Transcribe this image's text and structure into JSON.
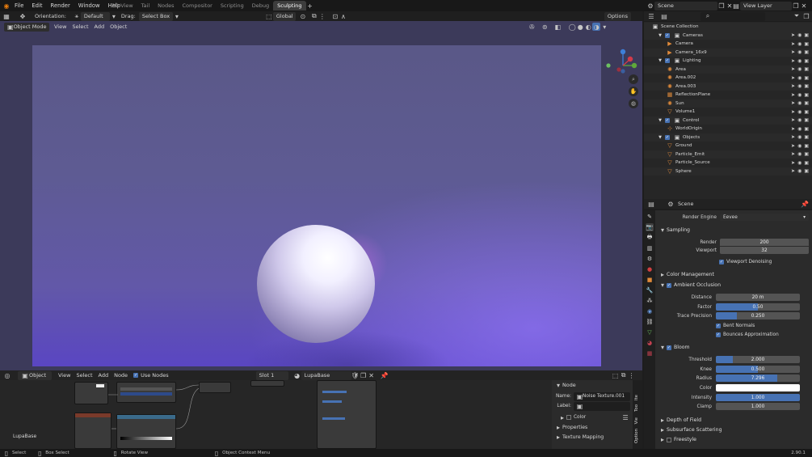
{
  "topbar": {
    "menus": [
      "File",
      "Edit",
      "Render",
      "Window",
      "Help"
    ],
    "workspaces": [
      "3D View",
      "Tail",
      "Nodes",
      "Compositor",
      "Scripting",
      "Debug",
      "Sculpting"
    ],
    "active_workspace": "Sculpting",
    "scene": "Scene",
    "view_layer": "View Layer"
  },
  "vp_toolbar": {
    "orientation_label": "Orientation:",
    "orientation_value": "Default",
    "drag_label": "Drag:",
    "drag_value": "Select Box",
    "transform_orientation": "Global",
    "options": "Options"
  },
  "vp_header": {
    "mode": "Object Mode",
    "menus": [
      "View",
      "Select",
      "Add",
      "Object"
    ]
  },
  "node_editor": {
    "type": "Object",
    "menus": [
      "View",
      "Select",
      "Add",
      "Node"
    ],
    "use_nodes": "Use Nodes",
    "slot": "Slot 1",
    "material": "LupaBase",
    "label_left": "LupaBase",
    "node_panel": {
      "title": "Node",
      "name_label": "Name:",
      "name_value": "Noise Texture.001",
      "label_label": "Label:",
      "color_label": "Color",
      "properties": "Properties",
      "texture_mapping": "Texture Mapping"
    },
    "side_tabs": [
      "Option",
      "Vie",
      "Too",
      "Ite"
    ]
  },
  "status": {
    "select": "Select",
    "box_select": "Box Select",
    "rotate_view": "Rotate View",
    "context_menu": "Object Context Menu",
    "version": "2.90.1"
  },
  "outliner": {
    "root": "Scene Collection",
    "rows": [
      {
        "name": "Cameras",
        "level": 1,
        "icon": "collection-icon",
        "expand": "▼"
      },
      {
        "name": "Camera",
        "level": 2,
        "icon": "camera-icon",
        "color": "#e08a3a"
      },
      {
        "name": "Camera_16x9",
        "level": 2,
        "icon": "camera-icon",
        "color": "#e08a3a"
      },
      {
        "name": "Lighting",
        "level": 1,
        "icon": "collection-icon",
        "expand": "▼"
      },
      {
        "name": "Area",
        "level": 2,
        "icon": "light-icon",
        "color": "#e08a3a"
      },
      {
        "name": "Area.002",
        "level": 2,
        "icon": "light-icon",
        "color": "#e08a3a"
      },
      {
        "name": "Area.003",
        "level": 2,
        "icon": "light-icon",
        "color": "#e08a3a"
      },
      {
        "name": "ReflectionPlane",
        "level": 2,
        "icon": "probe-icon",
        "color": "#e08a3a"
      },
      {
        "name": "Sun",
        "level": 2,
        "icon": "light-icon",
        "color": "#e08a3a"
      },
      {
        "name": "Volume1",
        "level": 2,
        "icon": "mesh-icon",
        "color": "#e08a3a"
      },
      {
        "name": "Control",
        "level": 1,
        "icon": "collection-icon",
        "expand": "▼"
      },
      {
        "name": "WorldOrigin",
        "level": 2,
        "icon": "empty-icon",
        "color": "#e08a3a"
      },
      {
        "name": "Objects",
        "level": 1,
        "icon": "collection-icon",
        "expand": "▼"
      },
      {
        "name": "Ground",
        "level": 2,
        "icon": "mesh-icon",
        "color": "#e08a3a"
      },
      {
        "name": "Particle_Emit",
        "level": 2,
        "icon": "mesh-icon",
        "color": "#e08a3a"
      },
      {
        "name": "Particle_Source",
        "level": 2,
        "icon": "mesh-icon",
        "color": "#e08a3a"
      },
      {
        "name": "Sphere",
        "level": 2,
        "icon": "mesh-icon",
        "color": "#e08a3a"
      }
    ]
  },
  "properties": {
    "context": "Scene",
    "render_engine_label": "Render Engine",
    "render_engine": "Eevee",
    "sampling": "Sampling",
    "render_label": "Render",
    "render_value": "200",
    "viewport_label": "Viewport",
    "viewport_value": "32",
    "viewport_denoising": "Viewport Denoising",
    "color_management": "Color Management",
    "ambient_occlusion": "Ambient Occlusion",
    "distance_label": "Distance",
    "distance_value": "20 m",
    "factor_label": "Factor",
    "factor_value": "0.50",
    "factor_fill": 0.5,
    "trace_label": "Trace Precision",
    "trace_value": "0.250",
    "trace_fill": 0.25,
    "bent_normals": "Bent Normals",
    "bounces": "Bounces Approximation",
    "bloom": "Bloom",
    "threshold_label": "Threshold",
    "threshold_value": "2.000",
    "threshold_fill": 0.2,
    "knee_label": "Knee",
    "knee_value": "0.500",
    "knee_fill": 0.5,
    "radius_label": "Radius",
    "radius_value": "7.296",
    "radius_fill": 0.73,
    "color_label": "Color",
    "intensity_label": "Intensity",
    "intensity_value": "1.000",
    "intensity_fill": 1.0,
    "clamp_label": "Clamp",
    "clamp_value": "1.000",
    "depth_of_field": "Depth of Field",
    "sss": "Subsurface Scattering",
    "freestyle": "Freestyle"
  },
  "colors": {
    "accent": "#4772b3",
    "orange": "#e08a3a",
    "green": "#6cc060"
  }
}
